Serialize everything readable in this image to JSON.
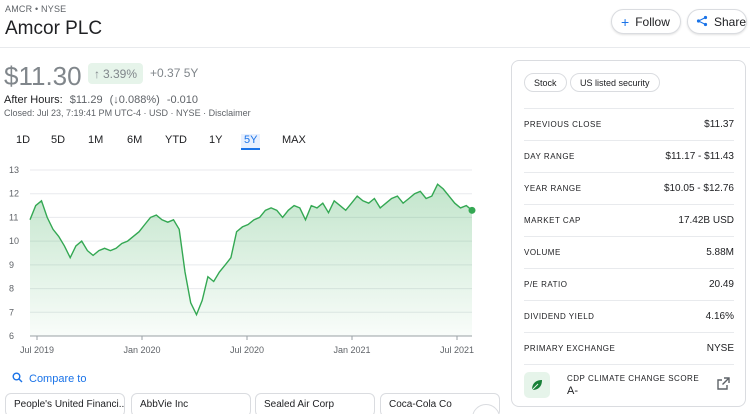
{
  "header": {
    "ticker": "AMCR • NYSE",
    "company": "Amcor PLC",
    "follow_label": "Follow",
    "share_label": "Share"
  },
  "quote": {
    "price": "$11.30",
    "pct_change": "3.39%",
    "abs_change": "+0.37 5Y",
    "after_hours_label": "After Hours:",
    "after_hours_price": "$11.29",
    "after_hours_pct": "(↓0.088%)",
    "after_hours_abs": "-0.010",
    "closed_text": "Closed: Jul 23, 7:19:41 PM UTC-4 · USD · NYSE · Disclaimer"
  },
  "ranges": [
    "1D",
    "5D",
    "1M",
    "6M",
    "YTD",
    "1Y",
    "5Y",
    "MAX"
  ],
  "active_range": "5Y",
  "chart_data": {
    "type": "area",
    "x_ticks": [
      "Jul 2019",
      "Jan 2020",
      "Jul 2020",
      "Jan 2021",
      "Jul 2021"
    ],
    "y_ticks": [
      6,
      7,
      8,
      9,
      10,
      11,
      12,
      13
    ],
    "ylim": [
      6,
      13
    ],
    "grid": true,
    "line_color": "#34a853",
    "fill_color": "#e6f4ea",
    "values": [
      10.9,
      11.5,
      11.7,
      11.0,
      10.5,
      10.2,
      9.8,
      9.3,
      9.8,
      10.0,
      9.6,
      9.4,
      9.6,
      9.7,
      9.6,
      9.7,
      9.9,
      10.0,
      10.2,
      10.4,
      10.7,
      11.0,
      11.1,
      10.9,
      10.8,
      10.9,
      10.5,
      8.7,
      7.4,
      6.9,
      7.5,
      8.5,
      8.3,
      8.7,
      9.0,
      9.3,
      10.4,
      10.6,
      10.7,
      10.9,
      11.0,
      11.3,
      11.4,
      11.3,
      11.0,
      11.3,
      11.5,
      11.4,
      10.9,
      11.5,
      11.4,
      11.6,
      11.2,
      11.7,
      11.5,
      11.3,
      11.6,
      11.9,
      11.7,
      11.6,
      11.8,
      11.4,
      11.6,
      11.8,
      11.9,
      11.6,
      11.8,
      12.0,
      12.1,
      11.8,
      11.9,
      12.4,
      12.2,
      11.9,
      11.6,
      11.4,
      11.5,
      11.3
    ],
    "last_value": 11.3
  },
  "compare": {
    "label": "Compare to"
  },
  "related": [
    "People's United Financi...",
    "AbbVie Inc",
    "Sealed Air Corp",
    "Coca-Cola Co"
  ],
  "panel": {
    "chips": [
      "Stock",
      "US listed security"
    ],
    "stats": [
      {
        "label": "PREVIOUS CLOSE",
        "value": "$11.37"
      },
      {
        "label": "DAY RANGE",
        "value": "$11.17 - $11.43"
      },
      {
        "label": "YEAR RANGE",
        "value": "$10.05 - $12.76"
      },
      {
        "label": "MARKET CAP",
        "value": "17.42B USD"
      },
      {
        "label": "VOLUME",
        "value": "5.88M"
      },
      {
        "label": "P/E RATIO",
        "value": "20.49"
      },
      {
        "label": "DIVIDEND YIELD",
        "value": "4.16%"
      },
      {
        "label": "PRIMARY EXCHANGE",
        "value": "NYSE"
      }
    ],
    "cdp_label": "CDP CLIMATE CHANGE SCORE",
    "cdp_value": "A-"
  },
  "icons": {
    "follow": "plus-icon",
    "share": "share-icon",
    "compare": "search-icon",
    "cdp": "leaf-icon",
    "open": "open-in-new-icon",
    "more": "chevron-right-icon"
  }
}
